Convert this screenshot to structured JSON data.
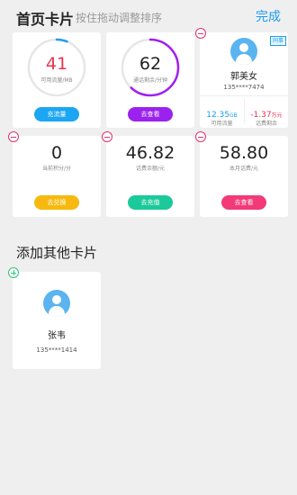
{
  "header": {
    "title": "首页卡片",
    "hint": "按住拖动调整排序",
    "done_label": "完成"
  },
  "cards": {
    "flow": {
      "value": "41",
      "label": "可用流量/MB",
      "button": "充流量",
      "progress": 0.06,
      "color": "#e8334f",
      "ring_color": "#1e9cf1",
      "button_color": "#1aa6f3"
    },
    "call": {
      "value": "62",
      "label": "通话剩余/分钟",
      "button": "去查看",
      "progress": 0.62,
      "color": "#222222",
      "ring_color": "#a020f0",
      "button_color": "#9b22ee"
    },
    "contact": {
      "name": "郭美女",
      "phone": "135****7474",
      "badge": "同事",
      "flow_value": "12.35",
      "flow_unit": "GB",
      "flow_label": "可用流量",
      "fee_value": "-1.37",
      "fee_unit": "万元",
      "fee_label": "话费剩余"
    },
    "points": {
      "value": "0",
      "label": "当前积分/分",
      "button": "去兑换",
      "button_color": "#f7b90f"
    },
    "balance": {
      "value": "46.82",
      "label": "话费余额/元",
      "button": "去充值",
      "button_color": "#1cc99a"
    },
    "monthly": {
      "value": "58.80",
      "label": "本月话费/元",
      "button": "去查看",
      "button_color": "#f23a78"
    }
  },
  "other_section": {
    "title": "添加其他卡片",
    "contact": {
      "name": "张韦",
      "phone": "135****1414"
    }
  }
}
